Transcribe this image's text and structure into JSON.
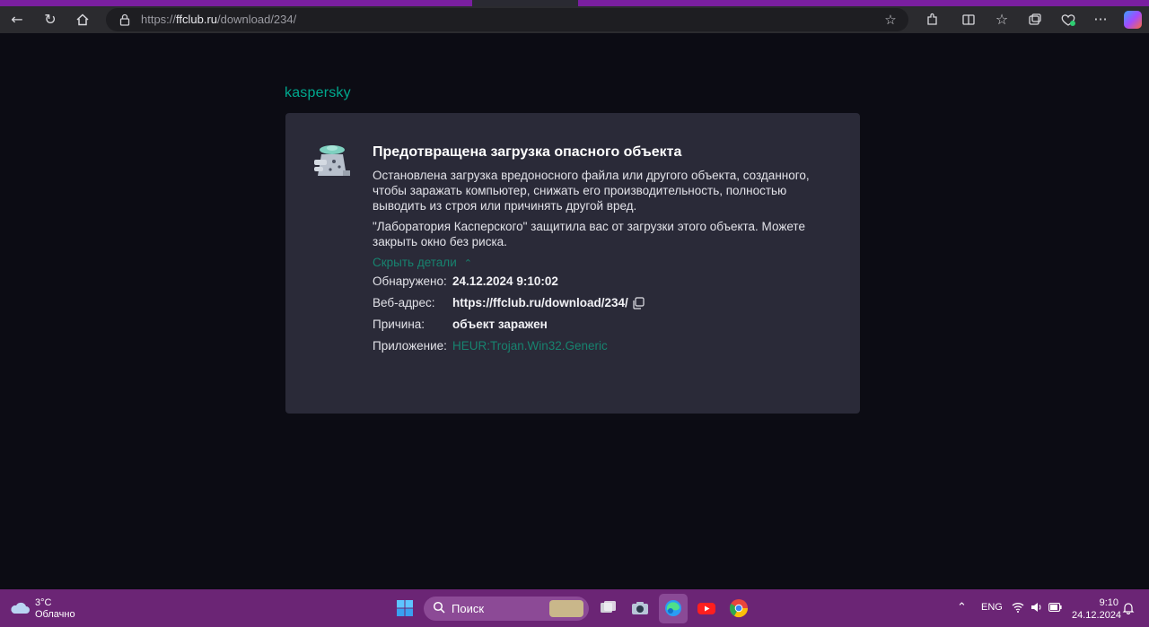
{
  "browser": {
    "url_prefix": "https://",
    "url_domain": "ffclub.ru",
    "url_path": "/download/234/"
  },
  "page": {
    "brand": "kaspersky",
    "title": "Предотвращена загрузка опасного объекта",
    "paragraph1": "Остановлена загрузка вредоносного файла или другого объекта, созданного, чтобы заражать компьютер, снижать его производительность, полностью выводить из строя или причинять другой вред.",
    "paragraph2": "\"Лаборатория Касперского\" защитила вас от загрузки этого объекта. Можете закрыть окно без риска.",
    "toggle_label": "Скрыть детали",
    "details": [
      {
        "label": "Обнаружено:",
        "value": "24.12.2024 9:10:02"
      },
      {
        "label": "Веб-адрес:",
        "value": "https://ffclub.ru/download/234/"
      },
      {
        "label": "Причина:",
        "value": "объект заражен"
      },
      {
        "label": "Приложение:",
        "value": "HEUR:Trojan.Win32.Generic"
      }
    ],
    "accent_color": "#00a88e"
  },
  "taskbar": {
    "weather_temp": "3°C",
    "weather_desc": "Облачно",
    "search_placeholder": "Поиск",
    "language": "ENG",
    "time": "9:10",
    "date": "24.12.2024"
  }
}
